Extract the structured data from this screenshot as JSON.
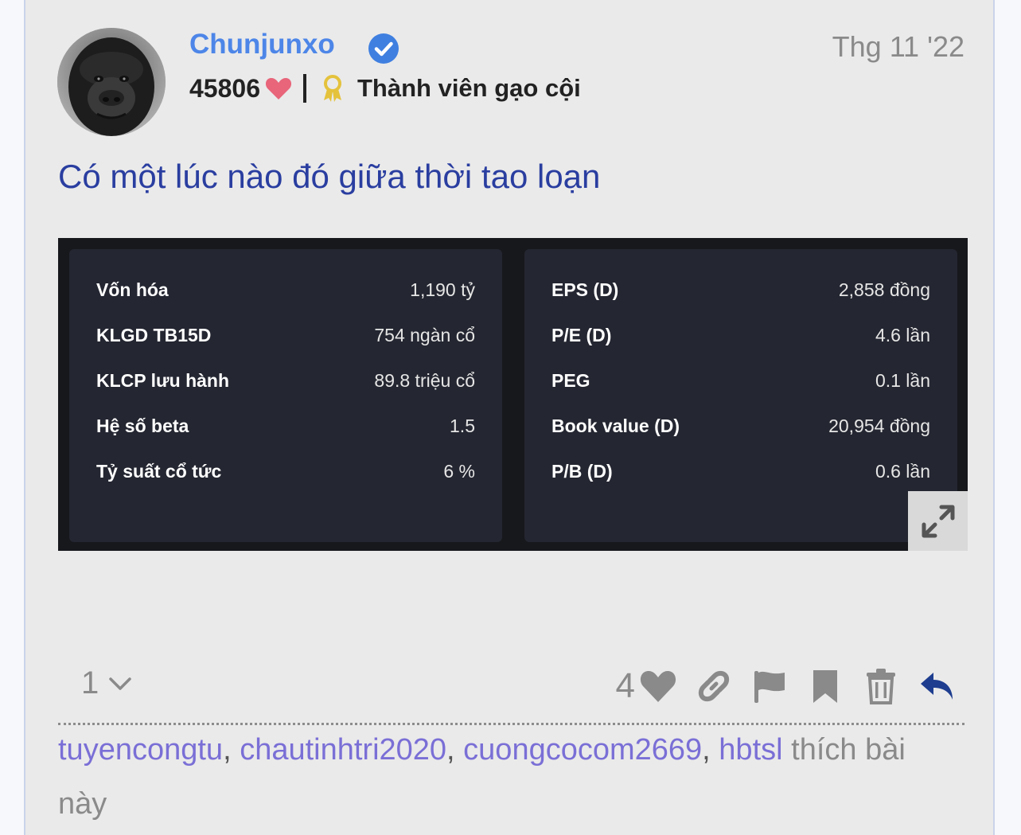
{
  "author": {
    "username": "Chunjunxo",
    "score": "45806",
    "rank": "Thành viên gạo cội"
  },
  "post": {
    "date": "Thg 11 '22",
    "title": "Có một lúc nào đó giữa thời tao loạn"
  },
  "stats_left": [
    {
      "label": "Vốn hóa",
      "value": "1,190 tỷ"
    },
    {
      "label": "KLGD TB15D",
      "value": "754 ngàn cổ"
    },
    {
      "label": "KLCP lưu hành",
      "value": "89.8 triệu cổ"
    },
    {
      "label": "Hệ số beta",
      "value": "1.5"
    },
    {
      "label": "Tỷ suất cổ tức",
      "value": "6 %"
    }
  ],
  "stats_right": [
    {
      "label": "EPS (D)",
      "value": "2,858 đồng"
    },
    {
      "label": "P/E (D)",
      "value": "4.6 lần"
    },
    {
      "label": "PEG",
      "value": "0.1 lần"
    },
    {
      "label": "Book value (D)",
      "value": "20,954 đồng"
    },
    {
      "label": "P/B (D)",
      "value": "0.6 lần"
    }
  ],
  "footer": {
    "post_number": "1",
    "like_count": "4",
    "likers": [
      "tuyencongtu",
      "chautinhtri2020",
      "cuongcocom2669",
      "hbtsl"
    ],
    "likers_suffix": " thích bài này"
  },
  "colors": {
    "username": "#4d86e8",
    "title": "#2a3ea0",
    "heart": "#e8657a",
    "reply": "#1e3d8f",
    "liker": "#7a6fd6"
  },
  "icons": [
    "verified-icon",
    "heart-icon",
    "award-icon",
    "expand-icon",
    "chevron-down-icon",
    "link-icon",
    "flag-icon",
    "bookmark-icon",
    "trash-icon",
    "reply-icon"
  ]
}
